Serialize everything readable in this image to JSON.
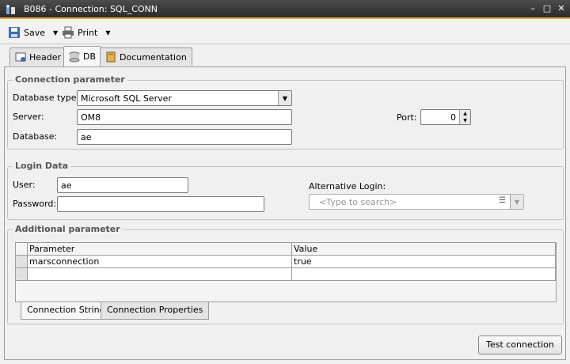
{
  "window": {
    "title": "B086 - Connection: SQL_CONN",
    "minimize_glyph": "–",
    "maximize_glyph": "□",
    "close_glyph": "✕"
  },
  "toolbar": {
    "save_label": "Save",
    "print_label": "Print"
  },
  "tabs": [
    {
      "label": "Header",
      "icon": "header-icon"
    },
    {
      "label": "DB",
      "icon": "database-icon",
      "active": true
    },
    {
      "label": "Documentation",
      "icon": "book-icon"
    }
  ],
  "connection": {
    "group_title": "Connection parameter",
    "database_type_label": "Database type:",
    "database_type_value": "Microsoft SQL Server",
    "server_label": "Server:",
    "server_value": "OM8",
    "database_label": "Database:",
    "database_value": "ae",
    "port_label": "Port:",
    "port_value": "0"
  },
  "login": {
    "group_title": "Login Data",
    "user_label": "User:",
    "user_value": "ae",
    "password_label": "Password:",
    "password_value": "",
    "alt_login_label": "Alternative Login:",
    "alt_login_placeholder": "<Type to search>"
  },
  "additional": {
    "group_title": "Additional parameter",
    "columns": [
      "Parameter",
      "Value"
    ],
    "rows": [
      {
        "parameter": "marsconnection",
        "value": "true"
      },
      {
        "parameter": "",
        "value": ""
      }
    ],
    "subtabs": [
      {
        "label": "Connection String",
        "active": true
      },
      {
        "label": "Connection Properties"
      }
    ]
  },
  "actions": {
    "test_connection_label": "Test connection"
  },
  "colors": {
    "titlebar": "#3a3a3a",
    "accent": "#e8a93c"
  }
}
